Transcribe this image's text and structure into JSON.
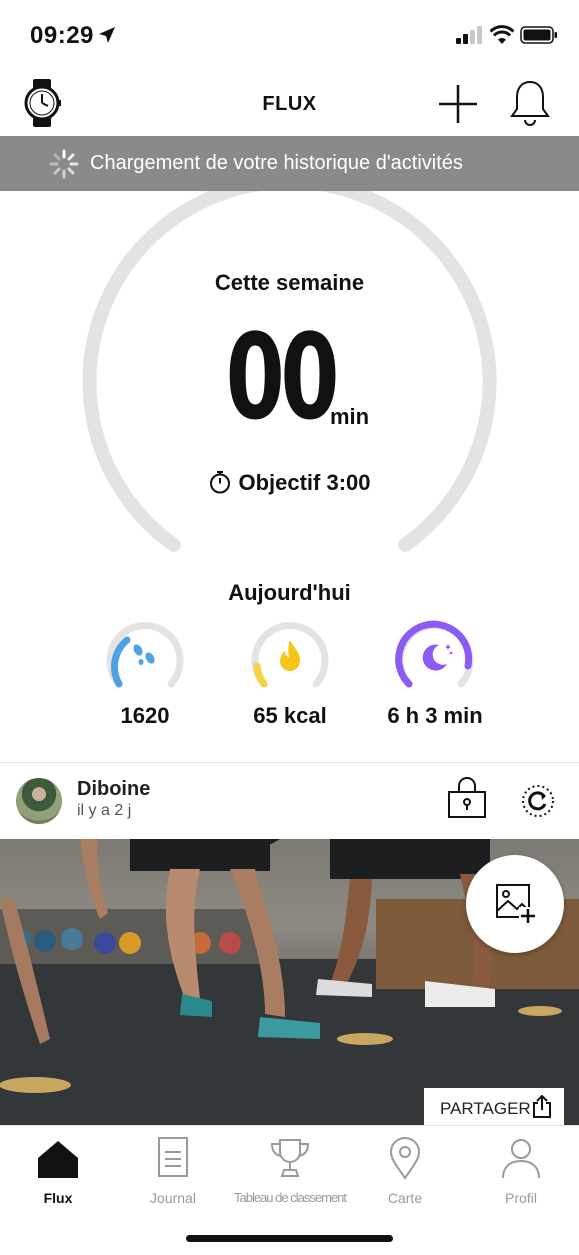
{
  "status_bar": {
    "time": "09:29"
  },
  "header": {
    "title": "FLUX"
  },
  "loading_banner": {
    "text": "Chargement de votre historique d'activités"
  },
  "weekly": {
    "label": "Cette semaine",
    "value": "00",
    "unit": "min",
    "goal": "Objectif 3:00",
    "progress": 0
  },
  "today": {
    "label": "Aujourd'hui",
    "steps": {
      "value": "1620",
      "icon": "footsteps-icon",
      "color": "#4da3e0"
    },
    "calories": {
      "value": "65 kcal",
      "icon": "flame-icon",
      "color": "#f5d23f"
    },
    "sleep": {
      "value": "6 h 3 min",
      "icon": "moon-icon",
      "color": "#8a5cf5"
    }
  },
  "post": {
    "user": "Diboine",
    "time_ago": "il y a 2 j",
    "share_label": "PARTAGER"
  },
  "bottom_nav": {
    "items": [
      {
        "label": "Flux",
        "icon": "home-icon",
        "active": true
      },
      {
        "label": "Journal",
        "icon": "journal-icon",
        "active": false
      },
      {
        "label": "Tableau de classement",
        "icon": "trophy-icon",
        "active": false
      },
      {
        "label": "Carte",
        "icon": "map-pin-icon",
        "active": false
      },
      {
        "label": "Profil",
        "icon": "profile-icon",
        "active": false
      }
    ]
  },
  "colors": {
    "banner_bg": "#8a8a8a",
    "ring_track": "#e3e3e3"
  }
}
